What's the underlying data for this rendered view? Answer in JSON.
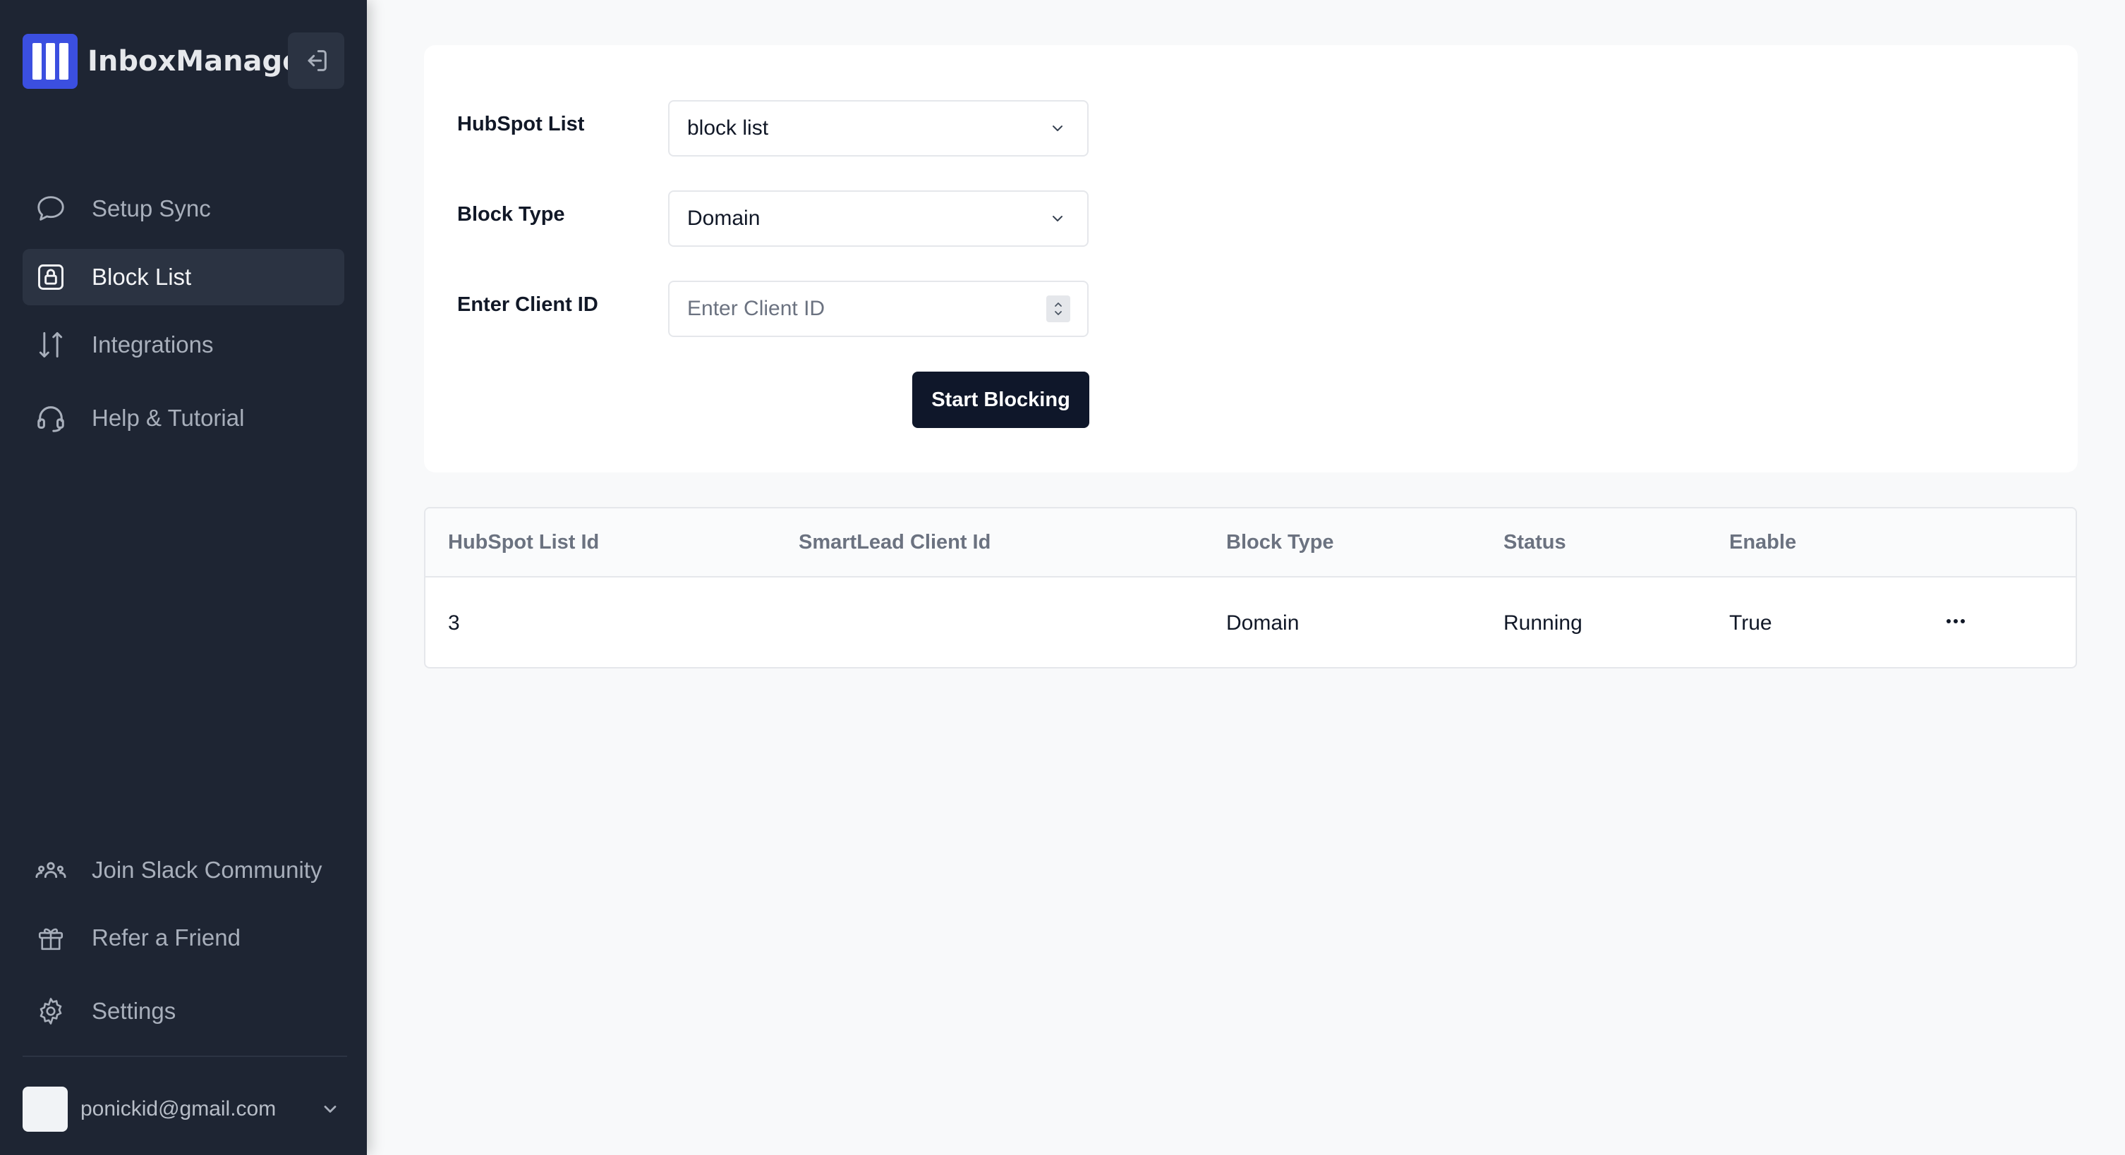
{
  "brand": {
    "name": "InboxManager"
  },
  "sidebar": {
    "nav": [
      {
        "label": "Setup Sync",
        "icon": "chat-bubble-icon"
      },
      {
        "label": "Block List",
        "icon": "lock-icon"
      },
      {
        "label": "Integrations",
        "icon": "arrows-up-down-icon"
      },
      {
        "label": "Help & Tutorial",
        "icon": "headset-icon"
      }
    ],
    "bottom": [
      {
        "label": "Join Slack Community",
        "icon": "community-icon"
      },
      {
        "label": "Refer a Friend",
        "icon": "gift-icon"
      },
      {
        "label": "Settings",
        "icon": "gear-icon"
      }
    ],
    "user": {
      "email": "ponickid@gmail.com"
    }
  },
  "form": {
    "hubspot_list_label": "HubSpot List",
    "hubspot_list_value": "block list",
    "block_type_label": "Block Type",
    "block_type_value": "Domain",
    "client_id_label": "Enter Client ID",
    "client_id_placeholder": "Enter Client ID",
    "start_button": "Start Blocking"
  },
  "table": {
    "headers": [
      "HubSpot List Id",
      "SmartLead Client Id",
      "Block Type",
      "Status",
      "Enable"
    ],
    "rows": [
      {
        "hubspot_list_id": "3",
        "smartlead_client_id": "",
        "block_type": "Domain",
        "status": "Running",
        "enable": "True"
      }
    ]
  },
  "colors": {
    "sidebar_bg": "#1e2533",
    "sidebar_active": "#2b3342",
    "brand_accent": "#3b4fe0",
    "primary_button": "#0f172a",
    "page_bg": "#f8f9fa"
  }
}
